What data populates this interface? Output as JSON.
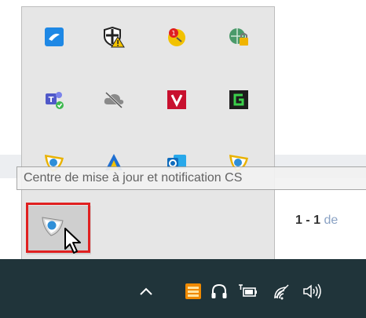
{
  "background": {
    "pagination_range": "1 - 1",
    "pagination_of": "de"
  },
  "tray_overflow": {
    "rows": [
      [
        "cloud-sync-icon",
        "shield-warning-icon",
        "clock-alert-icon",
        "vpn-lock-icon"
      ],
      [
        "teams-icon",
        "cloud-offline-icon",
        "v-app-icon",
        "green-g-icon"
      ],
      [
        "cs-update-icon",
        "a-app-icon",
        "outlook-icon",
        "cs-app-icon"
      ],
      [
        "cs-notification-icon"
      ]
    ],
    "tooltip": "Centre de mise à jour et notification CS"
  },
  "taskbar": {
    "icons": [
      "chevron-up-icon",
      "tray-app-icon",
      "headset-icon",
      "battery-icon",
      "wifi-icon",
      "volume-icon"
    ]
  },
  "colors": {
    "taskbar": "#20343a",
    "flyout": "#e6e6e6",
    "highlight": "#e02020",
    "accent_blue": "#2f8fd8"
  }
}
